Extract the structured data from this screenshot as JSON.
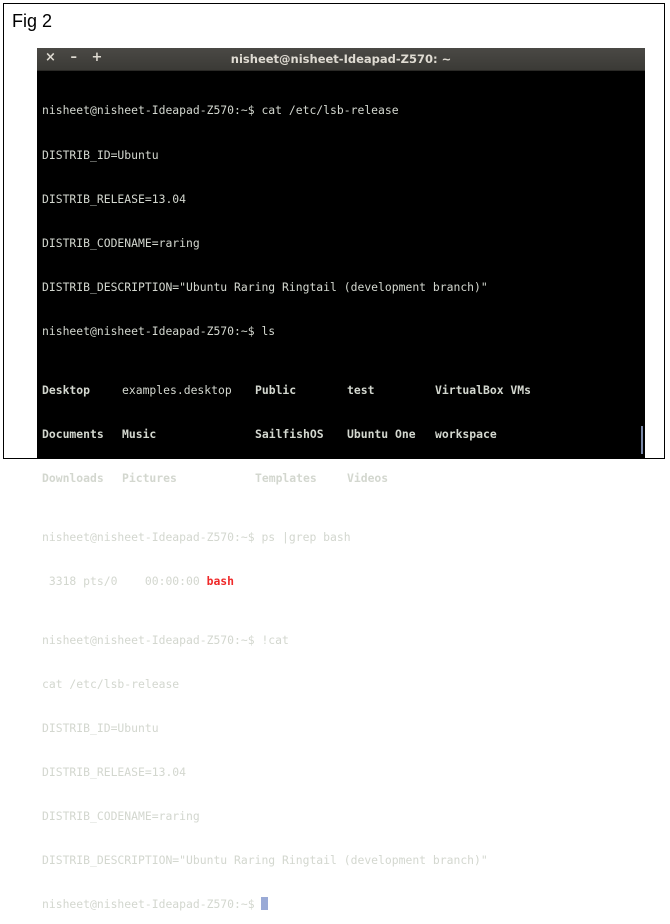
{
  "figure_label": "Fig 2",
  "window": {
    "title": "nisheet@nisheet-Ideapad-Z570: ~",
    "close_glyph": "×",
    "minimize_glyph": "–",
    "maximize_glyph": "+"
  },
  "terminal": {
    "lines": [
      "nisheet@nisheet-Ideapad-Z570:~$ cat /etc/lsb-release",
      "DISTRIB_ID=Ubuntu",
      "DISTRIB_RELEASE=13.04",
      "DISTRIB_CODENAME=raring",
      "DISTRIB_DESCRIPTION=\"Ubuntu Raring Ringtail (development branch)\"",
      "nisheet@nisheet-Ideapad-Z570:~$ ls"
    ],
    "ls_rows": [
      [
        "Desktop",
        "examples.desktop",
        "Public",
        "test",
        "VirtualBox VMs"
      ],
      [
        "Documents",
        "Music",
        "SailfishOS",
        "Ubuntu One",
        "workspace"
      ],
      [
        "Downloads",
        "Pictures",
        "Templates",
        "Videos",
        ""
      ]
    ],
    "ps_prompt": "nisheet@nisheet-Ideapad-Z570:~$ ps |grep bash",
    "ps_result": " 3318 pts/0    00:00:00 ",
    "ps_match": "bash",
    "lines2": [
      "nisheet@nisheet-Ideapad-Z570:~$ !cat",
      "cat /etc/lsb-release",
      "DISTRIB_ID=Ubuntu",
      "DISTRIB_RELEASE=13.04",
      "DISTRIB_CODENAME=raring",
      "DISTRIB_DESCRIPTION=\"Ubuntu Raring Ringtail (development branch)\""
    ],
    "final_prompt": "nisheet@nisheet-Ideapad-Z570:~$ "
  }
}
